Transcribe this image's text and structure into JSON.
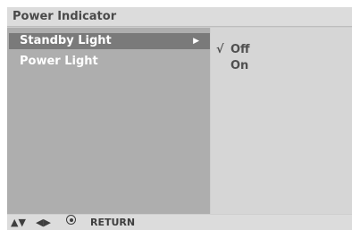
{
  "header": {
    "title": "Power Indicator"
  },
  "menu": {
    "items": [
      {
        "label": "Standby Light",
        "selected": true,
        "arrow": "▶"
      },
      {
        "label": "Power Light",
        "selected": false
      }
    ]
  },
  "options": {
    "items": [
      {
        "label": "Off",
        "check": "√",
        "checked": true
      },
      {
        "label": "On",
        "check": "",
        "checked": false
      }
    ]
  },
  "footer": {
    "updown_icon": "▲▼",
    "leftright_icon": "◀▶",
    "select_icon": "select-circle-icon",
    "return_label": "RETURN"
  },
  "colors": {
    "selected_row": "#7a7a7a",
    "left_pane": "#aeaeae",
    "right_pane": "#d6d6d6",
    "title_bar": "#dcdcdc"
  }
}
